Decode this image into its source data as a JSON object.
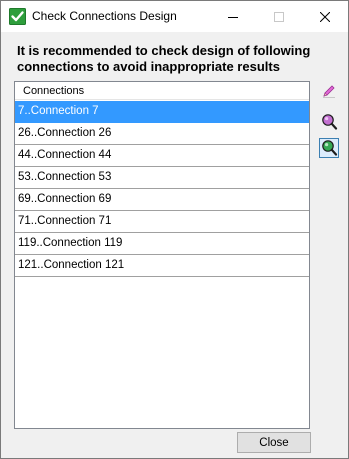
{
  "window": {
    "title": "Check Connections Design",
    "icon": "green-checkmark-icon"
  },
  "title_buttons": {
    "minimize": "minimize-icon",
    "maximize": "maximize-icon",
    "close": "close-icon"
  },
  "heading": "It is recommended to check design of following connections to avoid inappropriate results",
  "list": {
    "column_header": "Connections",
    "rows": [
      "7..Connection 7",
      "26..Connection 26",
      "44..Connection 44",
      "53..Connection 53",
      "69..Connection 69",
      "71..Connection 71",
      "119..Connection 119",
      "121..Connection 121"
    ],
    "selected_row": "7..Connection 7"
  },
  "toolbar": {
    "tools": [
      "edit-pencil-icon",
      "zoom-magnifier-icon",
      "zoom-fit-magnifier-icon"
    ]
  },
  "footer": {
    "close_label": "Close"
  },
  "colors": {
    "selection": "#3399ff",
    "window_bg": "#f0f0f0",
    "check_green": "#2e9e3c"
  }
}
